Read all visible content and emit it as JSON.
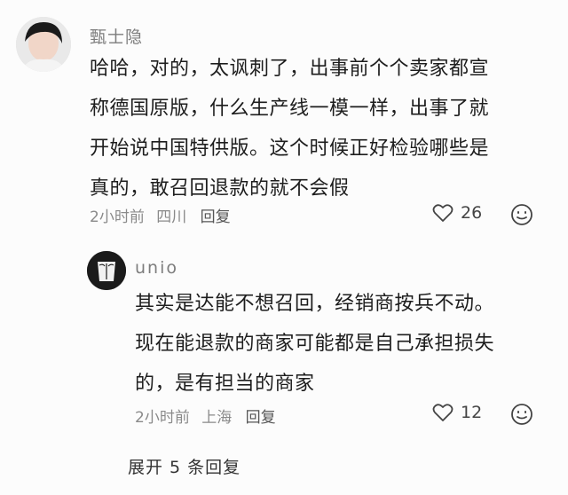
{
  "comment": {
    "username": "甄士隐",
    "lines": [
      "哈哈，对的，太讽刺了，出事前个个卖家都宣",
      "称德国原版，什么生产线一模一样，出事了就",
      "开始说中国特供版。这个时候正好检验哪些是",
      "真的，敢召回退款的就不会假"
    ],
    "time": "2小时前",
    "location": "四川",
    "reply_label": "回复",
    "likes": "26",
    "like_icon": "heart-outline-icon",
    "emoji_icon": "smiley-icon"
  },
  "reply": {
    "username": "unio",
    "lines": [
      "其实是达能不想召回，经销商按兵不动。",
      "现在能退款的商家可能都是自己承担损失",
      "的，是有担当的商家"
    ],
    "time": "2小时前",
    "location": "上海",
    "reply_label": "回复",
    "likes": "12",
    "like_icon": "heart-outline-icon",
    "emoji_icon": "smiley-icon"
  },
  "expand_label": "展开 5 条回复"
}
